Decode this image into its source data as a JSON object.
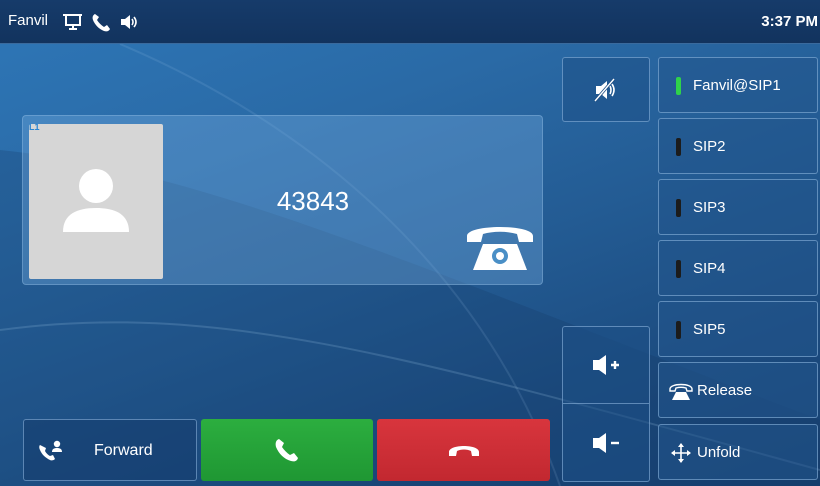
{
  "status_bar": {
    "brand": "Fanvil",
    "time": "3:37 PM",
    "icons": [
      "monitor-icon",
      "phone-icon",
      "speaker-icon"
    ]
  },
  "call": {
    "line_tag": "L1",
    "number": "43843",
    "avatar": "contact-avatar"
  },
  "controls": {
    "mute_icon": "speaker-mute-icon",
    "volume_up_icon": "volume-up-icon",
    "volume_down_icon": "volume-down-icon"
  },
  "line_keys": [
    {
      "label": "Fanvil@SIP1",
      "status": "active",
      "led_color": "#2fd24a"
    },
    {
      "label": "SIP2",
      "status": "idle",
      "led_color": "#1c1c1c"
    },
    {
      "label": "SIP3",
      "status": "idle",
      "led_color": "#1c1c1c"
    },
    {
      "label": "SIP4",
      "status": "idle",
      "led_color": "#1c1c1c"
    },
    {
      "label": "SIP5",
      "status": "idle",
      "led_color": "#1c1c1c"
    }
  ],
  "function_keys": {
    "release_label": "Release",
    "unfold_label": "Unfold"
  },
  "bottom_buttons": {
    "forward_label": "Forward",
    "answer_color": "#24a438",
    "reject_color": "#cf2f37"
  }
}
